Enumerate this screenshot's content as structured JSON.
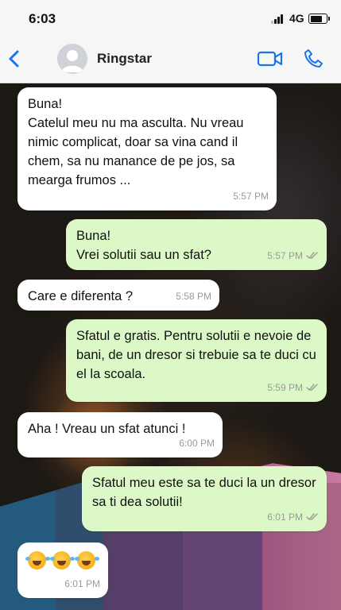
{
  "status_bar": {
    "time": "6:03",
    "network": "4G",
    "battery_level": 0.75
  },
  "header": {
    "contact_name": "Ringstar",
    "back_icon": "chevron-left-icon",
    "video_icon": "video-camera-icon",
    "call_icon": "phone-icon",
    "accent_color": "#1a73e8"
  },
  "messages": [
    {
      "direction": "incoming",
      "text": "Buna!\nCatelul meu nu ma asculta. Nu vreau nimic complicat, doar sa vina cand il chem, sa nu manance de pe jos, sa mearga frumos ...",
      "time": "5:57 PM"
    },
    {
      "direction": "outgoing",
      "text": "Buna!\nVrei solutii sau un sfat?",
      "time": "5:57 PM",
      "read": true
    },
    {
      "direction": "incoming",
      "text": "Care e diferenta ?",
      "time": "5:58 PM"
    },
    {
      "direction": "outgoing",
      "text": "Sfatul e gratis. Pentru solutii e nevoie de bani, de un dresor si trebuie sa te duci cu el la scoala.",
      "time": "5:59 PM",
      "read": true
    },
    {
      "direction": "incoming",
      "text": "Aha ! Vreau un sfat atunci !",
      "time": "6:00 PM"
    },
    {
      "direction": "outgoing",
      "text": "Sfatul meu este sa te duci la un dresor sa ti dea solutii!",
      "time": "6:01 PM",
      "read": true
    },
    {
      "direction": "incoming",
      "emoji": [
        "rolling-on-floor-laughing-icon",
        "rolling-on-floor-laughing-icon",
        "rolling-on-floor-laughing-icon"
      ],
      "time": "6:01 PM"
    }
  ],
  "colors": {
    "incoming_bubble": "#ffffff",
    "outgoing_bubble": "#dcf8c6",
    "timestamp": "#9a9a9a",
    "read_ticks": "#9a9a9a"
  }
}
